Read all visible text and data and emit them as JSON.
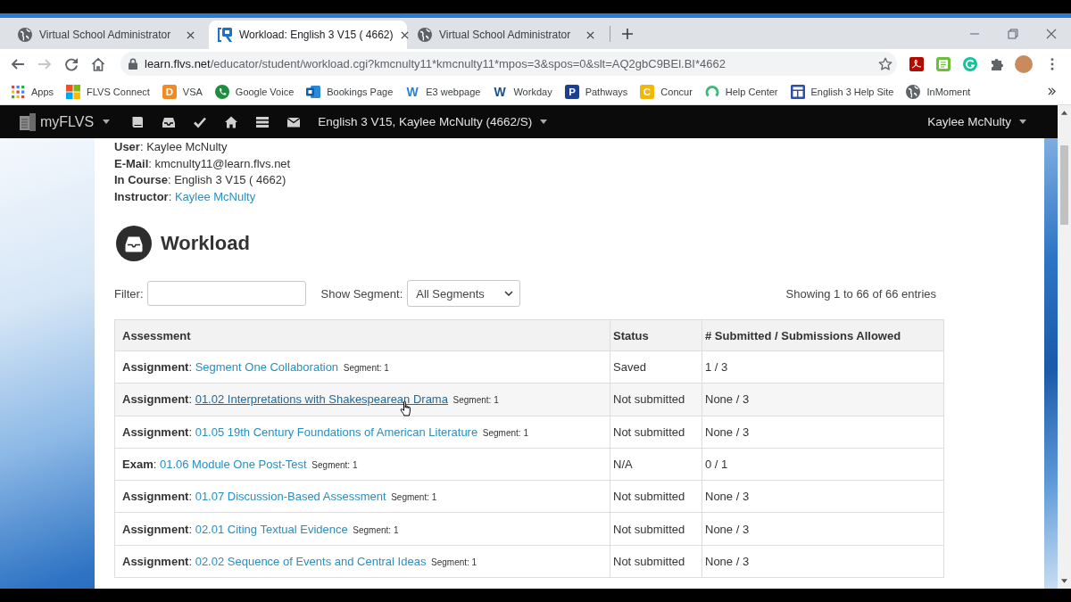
{
  "browser": {
    "tabs": [
      {
        "title": "Virtual School Administrator",
        "kind": "globe",
        "selected": false
      },
      {
        "title": "Workload: English 3 V15 ( 4662)",
        "kind": "site",
        "selected": true
      },
      {
        "title": "Virtual School Administrator",
        "kind": "globe",
        "selected": false
      }
    ],
    "navigation": {
      "back_disabled": false,
      "forward_disabled": true
    },
    "address_bar": {
      "host": "learn.flvs.net",
      "path": "/educator/student/workload.cgi?kmcnulty11*kmcnulty11*mpos=3&spos=0&slt=AQ2gbC9BEl.BI*4662"
    },
    "bookmarks": [
      {
        "label": "Apps",
        "kind": "apps"
      },
      {
        "label": "FLVS Connect",
        "kind": "tiles"
      },
      {
        "label": "VSA",
        "kind": "tile",
        "glyph": "D",
        "color": "#f08a24"
      },
      {
        "label": "Google Voice",
        "kind": "phone"
      },
      {
        "label": "Bookings Page",
        "kind": "bookings"
      },
      {
        "label": "E3 webpage",
        "kind": "letter",
        "glyph": "W",
        "color": "#2a7fd4"
      },
      {
        "label": "Workday",
        "kind": "letter",
        "glyph": "W",
        "color": "#1a4e8a"
      },
      {
        "label": "Pathways",
        "kind": "tile",
        "glyph": "P",
        "color": "#1d3f8f"
      },
      {
        "label": "Concur",
        "kind": "tile",
        "glyph": "C",
        "color": "#f2b705"
      },
      {
        "label": "Help Center",
        "kind": "ring"
      },
      {
        "label": "English 3 Help Site",
        "kind": "panel"
      },
      {
        "label": "InMoment",
        "kind": "globe"
      }
    ]
  },
  "app_nav": {
    "brand": "myFLVS",
    "course_menu": "English 3 V15, Kaylee McNulty (4662/S)",
    "user_menu": "Kaylee McNulty"
  },
  "student_info": [
    {
      "text": "**User**: Kaylee McNulty"
    },
    {
      "text": "**E-Mail**: kmcnulty11@learn.flvs.net"
    },
    {
      "text": "**In Course**: English 3 V15 ( 4662)"
    },
    {
      "text": "**Instructor**:",
      "link": "Kaylee McNulty"
    }
  ],
  "page_title": "Workload",
  "filters": {
    "filter_label": "Filter:",
    "segment_label": "Show Segment:",
    "segment_value": "All Segments",
    "entries": "Showing 1 to 66 of 66 entries"
  },
  "table": {
    "columns": [
      "Assessment",
      "Status",
      "# Submitted / Submissions Allowed"
    ],
    "rows": [
      {
        "type_label": "**Assignment**:",
        "title": "Segment One Collaboration",
        "segment": "Segment: 1",
        "status": "Saved",
        "submissions": "1 / 3",
        "hovered": false
      },
      {
        "type_label": "**Assignment**:",
        "title": "01.02 Interpretations with Shakespearean Drama",
        "segment": "Segment: 1",
        "status": "Not submitted",
        "submissions": "None / 3",
        "hovered": true
      },
      {
        "type_label": "**Assignment**:",
        "title": "01.05 19th Century Foundations of American Literature",
        "segment": "Segment: 1",
        "status": "Not submitted",
        "submissions": "None / 3",
        "hovered": false
      },
      {
        "type_label": "**Exam**:",
        "title": "01.06 Module One Post-Test",
        "segment": "Segment: 1",
        "status": "N/A",
        "submissions": "0 / 1",
        "hovered": false
      },
      {
        "type_label": "**Assignment**:",
        "title": "01.07 Discussion-Based Assessment",
        "segment": "Segment: 1",
        "status": "Not submitted",
        "submissions": "None / 3",
        "hovered": false
      },
      {
        "type_label": "**Assignment**:",
        "title": "02.01 Citing Textual Evidence",
        "segment": "Segment: 1",
        "status": "Not submitted",
        "submissions": "None / 3",
        "hovered": false
      },
      {
        "type_label": "**Assignment**:",
        "title": "02.02 Sequence of Events and Central Ideas",
        "segment": "Segment: 1",
        "status": "Not submitted",
        "submissions": "None / 3",
        "hovered": false
      }
    ]
  }
}
